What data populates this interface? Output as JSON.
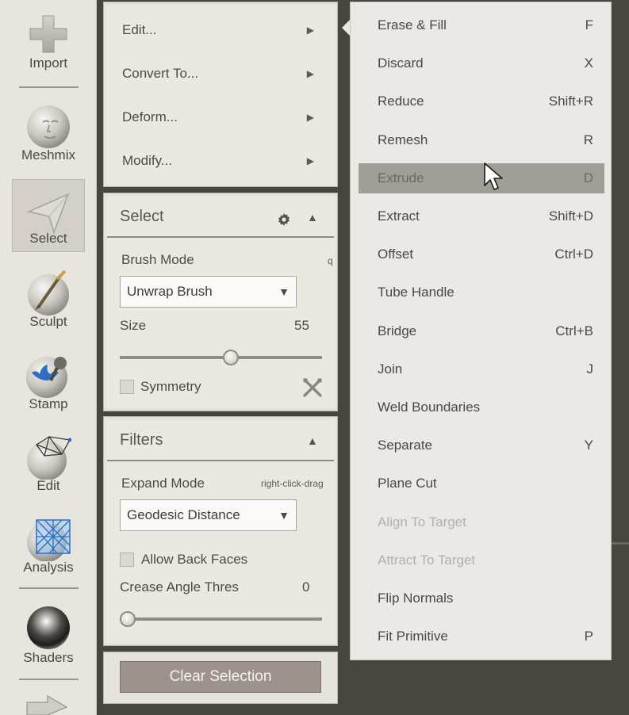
{
  "toolbar": {
    "items": [
      {
        "label": "Import",
        "icon": "plus-icon"
      },
      {
        "label": "Meshmix",
        "icon": "meshmix-sphere-icon"
      },
      {
        "label": "Select",
        "icon": "select-arrow-icon",
        "selected": true
      },
      {
        "label": "Sculpt",
        "icon": "brush-sphere-icon"
      },
      {
        "label": "Stamp",
        "icon": "stamp-sphere-icon"
      },
      {
        "label": "Edit",
        "icon": "edit-mesh-sphere-icon"
      },
      {
        "label": "Analysis",
        "icon": "analysis-mesh-icon"
      },
      {
        "label": "Shaders",
        "icon": "shader-sphere-icon"
      }
    ]
  },
  "actions_panel": {
    "items": [
      {
        "label": "Edit..."
      },
      {
        "label": "Convert To..."
      },
      {
        "label": "Deform..."
      },
      {
        "label": "Modify..."
      }
    ]
  },
  "select_panel": {
    "title": "Select",
    "brush_mode_label": "Brush Mode",
    "brush_mode_hint": "q",
    "brush_mode_value": "Unwrap Brush",
    "size_label": "Size",
    "size_value": "55",
    "size_fraction": 0.55,
    "symmetry_label": "Symmetry"
  },
  "filters_panel": {
    "title": "Filters",
    "expand_mode_label": "Expand Mode",
    "expand_mode_hint": "right-click-drag",
    "expand_mode_value": "Geodesic Distance",
    "allow_back_faces_label": "Allow Back Faces",
    "crease_label": "Crease Angle Thres",
    "crease_value": "0",
    "crease_fraction": 0
  },
  "clear_selection_label": "Clear Selection",
  "submenu": {
    "items": [
      {
        "label": "Erase & Fill",
        "key": "F"
      },
      {
        "label": "Discard",
        "key": "X"
      },
      {
        "label": "Reduce",
        "key": "Shift+R"
      },
      {
        "label": "Remesh",
        "key": "R"
      },
      {
        "label": "Extrude",
        "key": "D",
        "highlighted": true
      },
      {
        "label": "Extract",
        "key": "Shift+D"
      },
      {
        "label": "Offset",
        "key": "Ctrl+D"
      },
      {
        "label": "Tube Handle",
        "key": ""
      },
      {
        "label": "Bridge",
        "key": "Ctrl+B"
      },
      {
        "label": "Join",
        "key": "J"
      },
      {
        "label": "Weld Boundaries",
        "key": ""
      },
      {
        "label": "Separate",
        "key": "Y"
      },
      {
        "label": "Plane Cut",
        "key": ""
      },
      {
        "label": "Align To Target",
        "key": "",
        "disabled": true
      },
      {
        "label": "Attract To Target",
        "key": "",
        "disabled": true
      },
      {
        "label": "Flip Normals",
        "key": ""
      },
      {
        "label": "Fit Primitive",
        "key": "P"
      }
    ]
  },
  "colors": {
    "background": "#48453f",
    "panel": "#ebe8e2",
    "highlight": "#a19d97",
    "button": "#9e938c"
  }
}
